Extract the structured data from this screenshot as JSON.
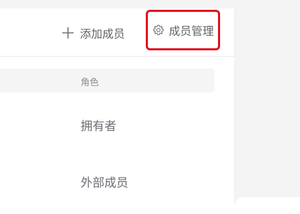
{
  "toolbar": {
    "add_member_label": "添加成员",
    "manage_members_label": "成员管理"
  },
  "table": {
    "columns": [
      {
        "label": "角色"
      }
    ],
    "rows": [
      {
        "role": "拥有者"
      },
      {
        "role": "外部成员"
      }
    ]
  },
  "highlight": {
    "color": "#e01020"
  }
}
